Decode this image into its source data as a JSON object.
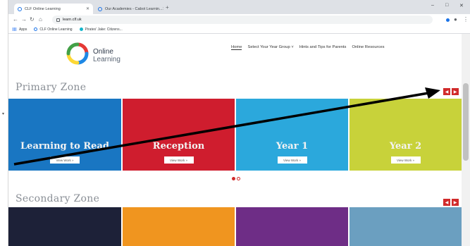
{
  "browser": {
    "tabs": [
      {
        "title": "CLF Online Learning",
        "active": true
      },
      {
        "title": "Our Academies - Cabot Learnin...",
        "active": false
      }
    ],
    "new_tab": "+",
    "window_controls": {
      "minimize": "–",
      "maximize": "□",
      "close": "✕"
    },
    "url": "learn.clf.uk",
    "bookmarks": [
      {
        "label": "Apps",
        "icon": "apps-grid-icon"
      },
      {
        "label": "CLF Online Learning",
        "icon": "clf-favicon"
      },
      {
        "label": "Pirates' Jake: Citizens...",
        "icon": "site-favicon"
      }
    ]
  },
  "site": {
    "logo": {
      "line1": "Online",
      "line2": "Learning"
    },
    "nav": [
      "Home",
      "Select Your Year Group ˅",
      "Hints and Tips for Parents",
      "Online Resources"
    ],
    "primary_zone": {
      "title": "Primary Zone",
      "slides": [
        {
          "title": "Learning to Read",
          "button": "View Work »",
          "color": "#1976c2"
        },
        {
          "title": "Reception",
          "button": "View Work »",
          "color": "#cf1d2e"
        },
        {
          "title": "Year 1",
          "button": "View Work »",
          "color": "#2ba8dc"
        },
        {
          "title": "Year 2",
          "button": "View Work »",
          "color": "#c8d23a"
        }
      ]
    },
    "secondary_zone": {
      "title": "Secondary Zone",
      "colors": [
        "#1d2138",
        "#f0951f",
        "#6e2d86",
        "#6b9fc0"
      ]
    },
    "arrow_prev": "◀",
    "arrow_next": "▶",
    "accent": "#d12b2b"
  },
  "annotation": {
    "type": "arrow",
    "color": "#000000"
  }
}
